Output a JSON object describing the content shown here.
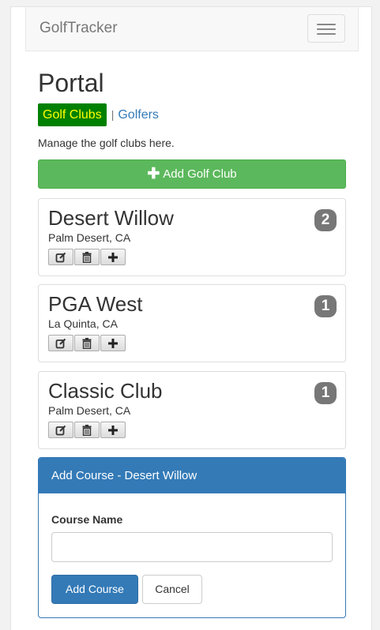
{
  "navbar": {
    "brand": "GolfTracker",
    "menu_icon": "hamburger-menu-icon"
  },
  "page": {
    "title": "Portal",
    "tabs": [
      {
        "label": "Golf Clubs",
        "active": true
      },
      {
        "label": "Golfers",
        "active": false
      }
    ],
    "separator": "|",
    "description": "Manage the golf clubs here."
  },
  "add_club_button": {
    "icon": "plus-icon",
    "label": "Add Golf Club"
  },
  "clubs": [
    {
      "name": "Desert Willow",
      "location": "Palm Desert, CA",
      "count": "2"
    },
    {
      "name": "PGA West",
      "location": "La Quinta, CA",
      "count": "1"
    },
    {
      "name": "Classic Club",
      "location": "Palm Desert, CA",
      "count": "1"
    }
  ],
  "club_action_icons": [
    "edit-icon",
    "trash-icon",
    "plus-icon"
  ],
  "add_course_panel": {
    "title": "Add Course - Desert Willow",
    "field_label": "Course Name",
    "field_value": "",
    "submit_label": "Add Course",
    "cancel_label": "Cancel"
  },
  "colors": {
    "active_tab_bg": "#008000",
    "active_tab_text": "#ffff00",
    "link": "#337ab7",
    "success": "#5cb85c",
    "primary": "#337ab7",
    "badge": "#777777"
  }
}
